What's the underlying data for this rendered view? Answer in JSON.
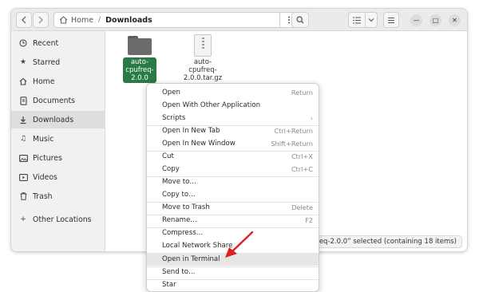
{
  "headerbar": {
    "back_icon": "chevron-left-icon",
    "forward_icon": "chevron-right-icon",
    "path_home": "Home",
    "path_separator": "/",
    "path_current": "Downloads",
    "path_menu_icon": "kebab-menu-icon",
    "search_icon": "search-icon",
    "view_icon": "list-view-icon",
    "view_dropdown_icon": "chevron-down-icon",
    "menu_icon": "hamburger-menu-icon",
    "minimize_label": "—",
    "maximize_label": "□",
    "close_label": "✕"
  },
  "sidebar": {
    "items": [
      {
        "label": "Recent",
        "icon": "clock-icon"
      },
      {
        "label": "Starred",
        "icon": "star-icon"
      },
      {
        "label": "Home",
        "icon": "home-icon"
      },
      {
        "label": "Documents",
        "icon": "document-icon"
      },
      {
        "label": "Downloads",
        "icon": "download-icon",
        "active": true
      },
      {
        "label": "Music",
        "icon": "music-icon"
      },
      {
        "label": "Pictures",
        "icon": "picture-icon"
      },
      {
        "label": "Videos",
        "icon": "video-icon"
      },
      {
        "label": "Trash",
        "icon": "trash-icon"
      },
      {
        "label": "Other Locations",
        "icon": "plus-icon"
      }
    ]
  },
  "files": [
    {
      "name_lines": [
        "auto-",
        "cpufreq-",
        "2.0.0"
      ],
      "type": "folder",
      "selected": true
    },
    {
      "name_lines": [
        "auto-",
        "cpufreq-",
        "2.0.0.tar.gz"
      ],
      "type": "archive",
      "selected": false
    }
  ],
  "status": {
    "text": "ufreq-2.0.0” selected  (containing 18 items)"
  },
  "context_menu": {
    "items": [
      {
        "label": "Open",
        "accel": "Return"
      },
      {
        "label": "Open With Other Application",
        "accel": ""
      },
      {
        "label": "Scripts",
        "accel": "›"
      },
      {
        "label": "Open In New Tab",
        "accel": "Ctrl+Return"
      },
      {
        "label": "Open In New Window",
        "accel": "Shift+Return"
      },
      {
        "label": "Cut",
        "accel": "Ctrl+X"
      },
      {
        "label": "Copy",
        "accel": "Ctrl+C"
      },
      {
        "label": "Move to…",
        "accel": ""
      },
      {
        "label": "Copy to…",
        "accel": ""
      },
      {
        "label": "Move to Trash",
        "accel": "Delete"
      },
      {
        "label": "Rename…",
        "accel": "F2"
      },
      {
        "label": "Compress…",
        "accel": ""
      },
      {
        "label": "Local Network Share",
        "accel": ""
      },
      {
        "label": "Open in Terminal",
        "accel": "",
        "highlighted": true
      },
      {
        "label": "Send to…",
        "accel": ""
      },
      {
        "label": "Star",
        "accel": ""
      }
    ]
  },
  "colors": {
    "selection": "#2a7a45",
    "arrow": "#e02020"
  }
}
